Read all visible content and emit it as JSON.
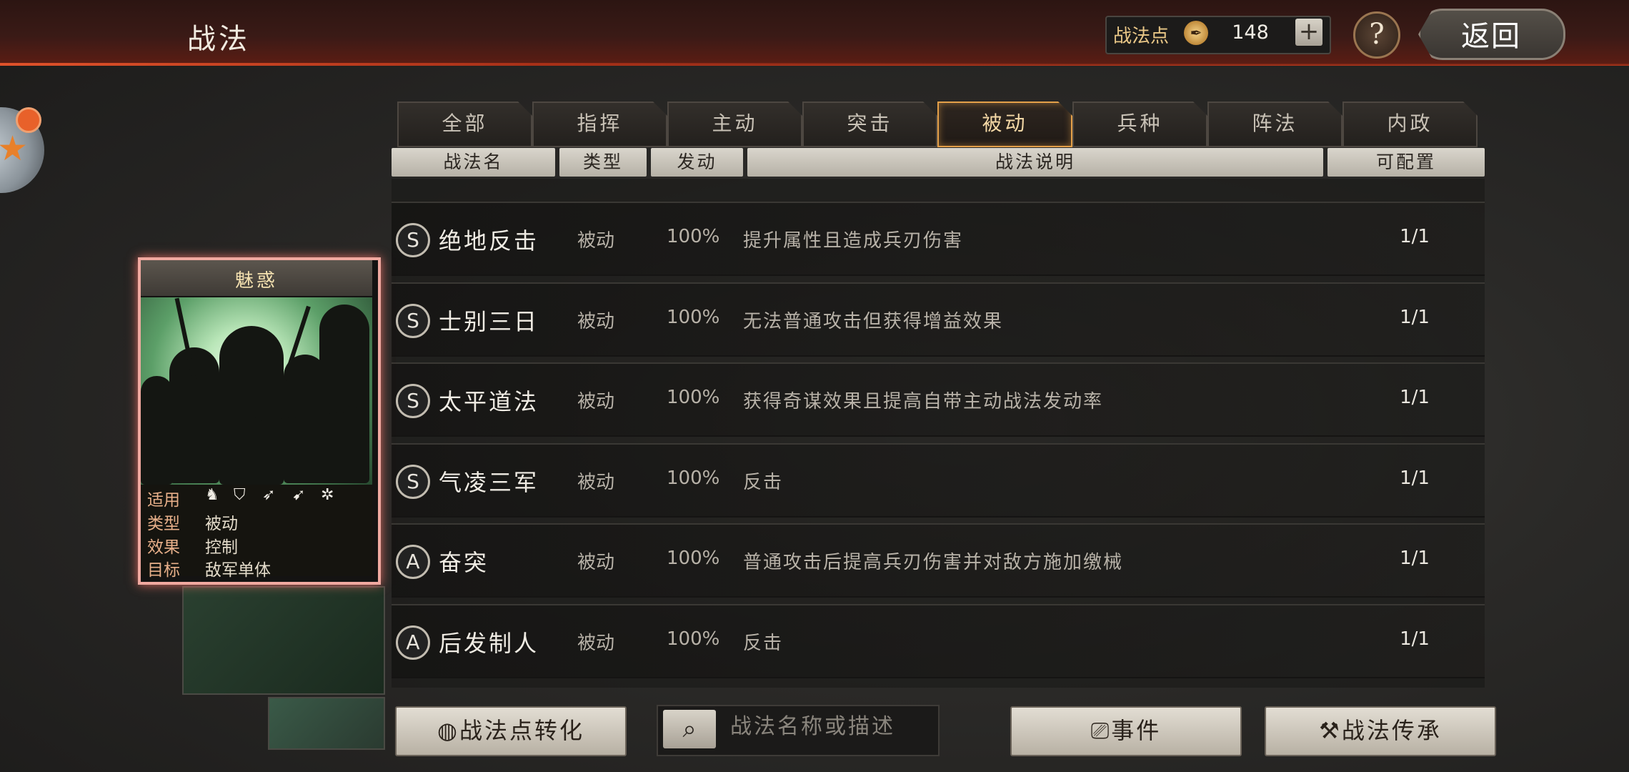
{
  "header": {
    "title": "战法",
    "points_label": "战法点",
    "points_value": "148",
    "plus": "+",
    "help": "?",
    "back": "返回"
  },
  "tabs": [
    "全部",
    "指挥",
    "主动",
    "突击",
    "被动",
    "兵种",
    "阵法",
    "内政"
  ],
  "active_tab": "被动",
  "table_header": {
    "name": "战法名",
    "type": "类型",
    "rate": "发动",
    "desc": "战法说明",
    "count": "可配置"
  },
  "skills": [
    {
      "grade": "S",
      "name": "绝地反击",
      "type": "被动",
      "rate": "100%",
      "desc": "提升属性且造成兵刃伤害",
      "count": "1/1"
    },
    {
      "grade": "S",
      "name": "士别三日",
      "type": "被动",
      "rate": "100%",
      "desc": "无法普通攻击但获得增益效果",
      "count": "1/1"
    },
    {
      "grade": "S",
      "name": "太平道法",
      "type": "被动",
      "rate": "100%",
      "desc": "获得奇谋效果且提高自带主动战法发动率",
      "count": "1/1"
    },
    {
      "grade": "S",
      "name": "气凌三军",
      "type": "被动",
      "rate": "100%",
      "desc": "反击",
      "count": "1/1"
    },
    {
      "grade": "A",
      "name": "奋突",
      "type": "被动",
      "rate": "100%",
      "desc": "普通攻击后提高兵刃伤害并对敌方施加缴械",
      "count": "1/1"
    },
    {
      "grade": "A",
      "name": "后发制人",
      "type": "被动",
      "rate": "100%",
      "desc": "反击",
      "count": "1/1"
    }
  ],
  "card": {
    "title": "魅惑",
    "applicable_label": "适用",
    "type_label": "类型",
    "type_value": "被动",
    "effect_label": "效果",
    "effect_value": "控制",
    "target_label": "目标",
    "target_value": "敌军单体",
    "unit_icons": [
      "cavalry-icon",
      "shield-icon",
      "bow-icon",
      "spear-icon",
      "wheel-icon"
    ]
  },
  "bottom": {
    "convert_label": "战法点转化",
    "search_placeholder": "战法名称或描述",
    "event_label": "事件",
    "inherit_label": "战法传承"
  }
}
